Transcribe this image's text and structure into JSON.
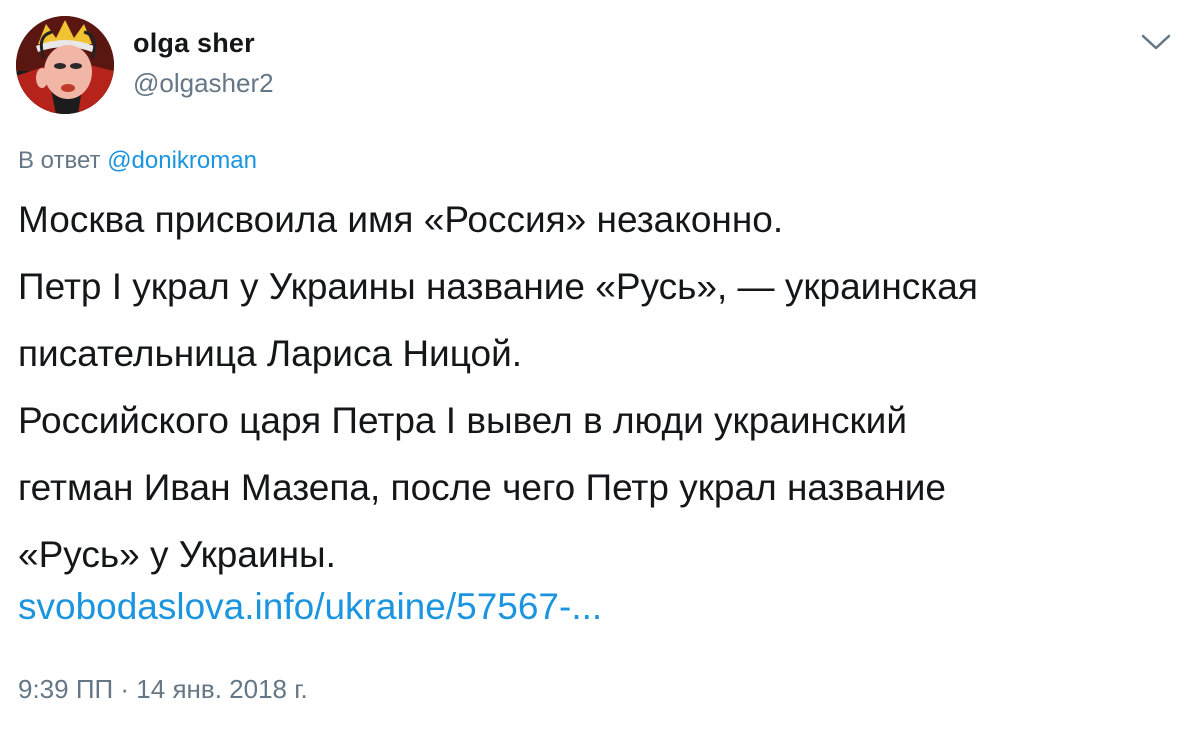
{
  "user": {
    "display_name": "olga sher",
    "username": "@olgasher2",
    "avatar_icon": "cartoon-queen-avatar"
  },
  "menu": {
    "icon": "chevron-down-icon"
  },
  "reply": {
    "prefix": "В ответ",
    "mention": "@donikroman"
  },
  "tweet": {
    "lines": [
      "Москва присвоила имя «Россия» незаконно.",
      "Петр I украл у Украины название «Русь», — украинская",
      "писательница Лариса Ницой.",
      "Российского царя Петра I вывел в люди украинский",
      "гетман Иван Мазепа, после чего Петр украл название",
      "«Русь» у Украины."
    ],
    "link": "svobodaslova.info/ukraine/57567-...",
    "timestamp": "9:39 ПП · 14 янв. 2018 г."
  },
  "colors": {
    "text": "#14171a",
    "secondary": "#657786",
    "link": "#1b95e0"
  }
}
